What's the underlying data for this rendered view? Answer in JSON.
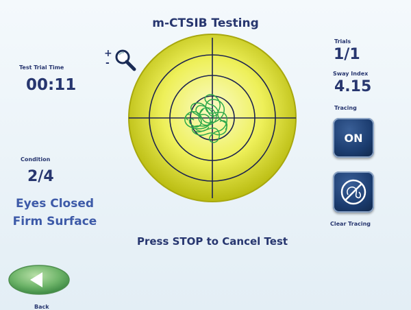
{
  "header": {
    "title": "m-CTSIB Testing"
  },
  "left": {
    "trial_time_label": "Test Trial Time",
    "trial_time_value": "00:11",
    "condition_label": "Condition",
    "condition_value": "2/4",
    "condition_line1": "Eyes Closed",
    "condition_line2": "Firm Surface"
  },
  "right": {
    "trials_label": "Trials",
    "trials_value": "1/1",
    "sway_label": "Sway Index",
    "sway_value": "4.15",
    "tracing_label": "Tracing",
    "tracing_button": "ON",
    "clear_label": "Clear Tracing"
  },
  "zoom": {
    "plus": "+",
    "minus": "-",
    "icon": "magnifier-icon"
  },
  "footer": {
    "message": "Press STOP to Cancel Test"
  },
  "back": {
    "label": "Back",
    "icon": "back-arrow-icon"
  },
  "colors": {
    "target_yellow": "#e8ea3a",
    "trace_green": "#2ea84a",
    "button_blue": "#1b3c6f",
    "back_green": "#6fb56a",
    "text_navy": "#27366f"
  }
}
